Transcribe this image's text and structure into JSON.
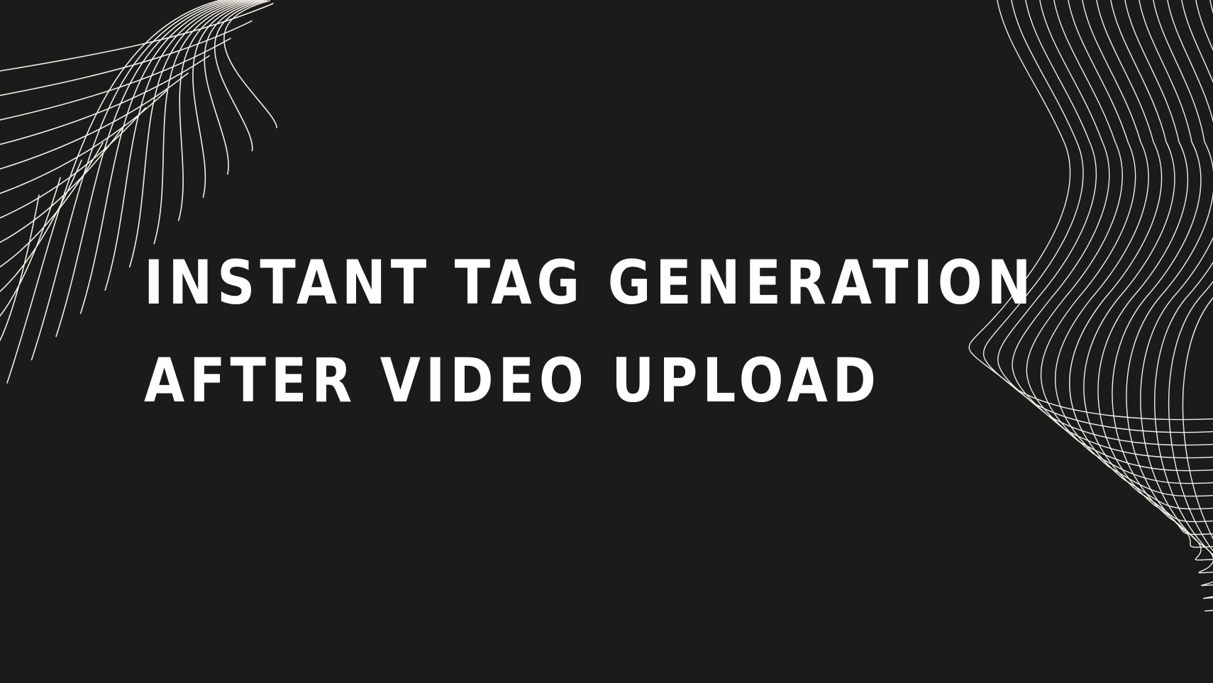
{
  "slide": {
    "background_color": "#1b1b1b",
    "line_color": "#f2efe6",
    "text_color": "#ffffff",
    "title_line_1": "INSTANT TAG GENERATION",
    "title_line_2": "AFTER VIDEO UPLOAD",
    "decor_left": "wireframe-mesh",
    "decor_right": "wavy-lines"
  }
}
